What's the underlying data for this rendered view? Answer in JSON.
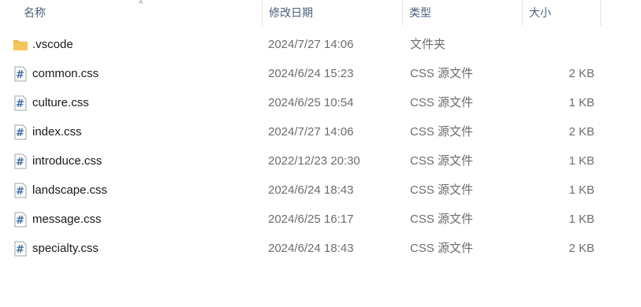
{
  "columns": {
    "name": "名称",
    "modified": "修改日期",
    "type": "类型",
    "size": "大小"
  },
  "rows": [
    {
      "name": ".vscode",
      "modified": "2024/7/27 14:06",
      "type": "文件夹",
      "size": "",
      "icon": "folder-icon"
    },
    {
      "name": "common.css",
      "modified": "2024/6/24 15:23",
      "type": "CSS 源文件",
      "size": "2 KB",
      "icon": "css-file-icon"
    },
    {
      "name": "culture.css",
      "modified": "2024/6/25 10:54",
      "type": "CSS 源文件",
      "size": "1 KB",
      "icon": "css-file-icon"
    },
    {
      "name": "index.css",
      "modified": "2024/7/27 14:06",
      "type": "CSS 源文件",
      "size": "2 KB",
      "icon": "css-file-icon"
    },
    {
      "name": "introduce.css",
      "modified": "2022/12/23 20:30",
      "type": "CSS 源文件",
      "size": "1 KB",
      "icon": "css-file-icon"
    },
    {
      "name": "landscape.css",
      "modified": "2024/6/24 18:43",
      "type": "CSS 源文件",
      "size": "1 KB",
      "icon": "css-file-icon"
    },
    {
      "name": "message.css",
      "modified": "2024/6/25 16:17",
      "type": "CSS 源文件",
      "size": "1 KB",
      "icon": "css-file-icon"
    },
    {
      "name": "specialty.css",
      "modified": "2024/6/24 18:43",
      "type": "CSS 源文件",
      "size": "2 KB",
      "icon": "css-file-icon"
    }
  ],
  "colors": {
    "header_text": "#4c607a",
    "secondary_text": "#6d6d6d",
    "folder": "#f4c55b",
    "css_icon": "#3b6ea5"
  }
}
